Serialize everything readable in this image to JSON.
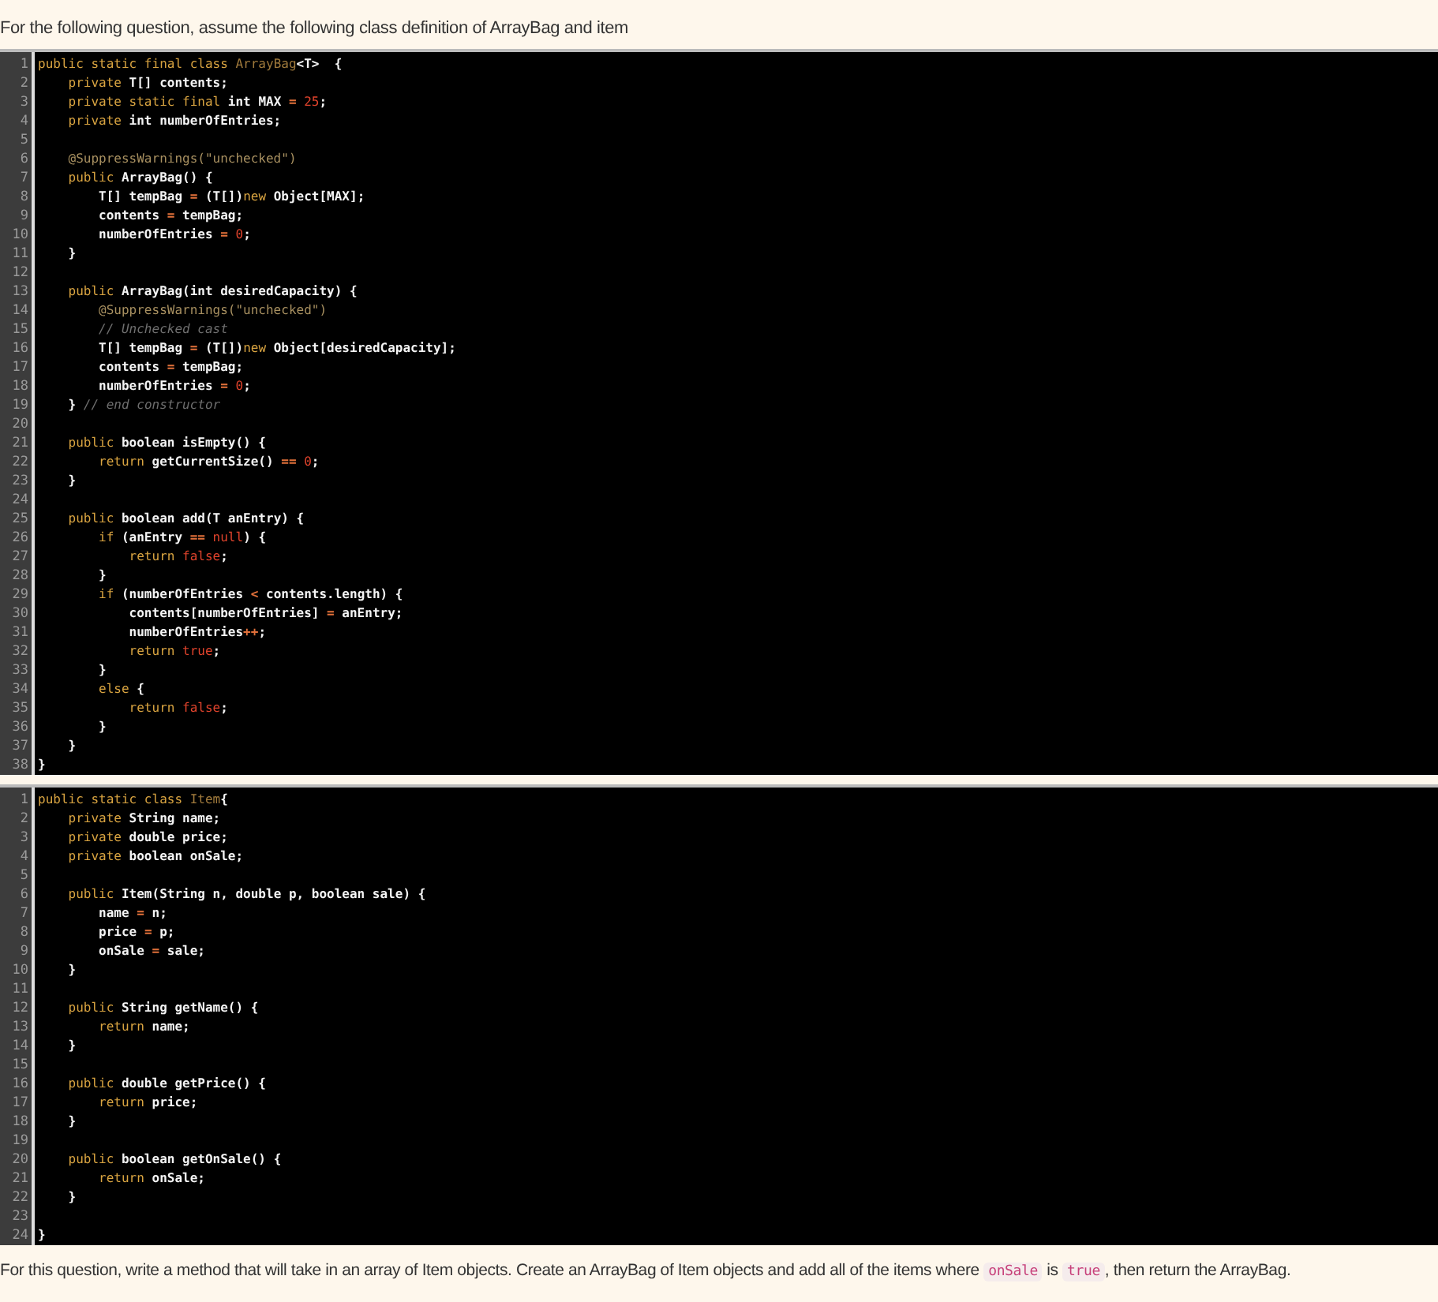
{
  "intro": "For the following question, assume the following class definition of ArrayBag and item",
  "code_blocks": [
    {
      "lines": [
        {
          "number": "1",
          "tokens": [
            {
              "kind": "kw",
              "text": "public static final class "
            },
            {
              "kind": "cls",
              "text": "ArrayBag"
            },
            {
              "kind": "plain",
              "text": "<T>  {"
            }
          ]
        },
        {
          "number": "2",
          "tokens": [
            {
              "kind": "kw",
              "text": "    private "
            },
            {
              "kind": "plain",
              "text": "T[] contents;"
            }
          ]
        },
        {
          "number": "3",
          "tokens": [
            {
              "kind": "kw",
              "text": "    private static final "
            },
            {
              "kind": "plain",
              "text": "int MAX "
            },
            {
              "kind": "op",
              "text": "= "
            },
            {
              "kind": "num",
              "text": "25"
            },
            {
              "kind": "plain",
              "text": ";"
            }
          ]
        },
        {
          "number": "4",
          "tokens": [
            {
              "kind": "kw",
              "text": "    private "
            },
            {
              "kind": "plain",
              "text": "int numberOfEntries;"
            }
          ]
        },
        {
          "number": "5"
        },
        {
          "number": "6",
          "tokens": [
            {
              "kind": "ann",
              "text": "    @SuppressWarnings(\"unchecked\")"
            }
          ]
        },
        {
          "number": "7",
          "tokens": [
            {
              "kind": "kw",
              "text": "    public "
            },
            {
              "kind": "plain",
              "text": "ArrayBag() {"
            }
          ]
        },
        {
          "number": "8",
          "tokens": [
            {
              "kind": "plain",
              "text": "        T[] tempBag "
            },
            {
              "kind": "op",
              "text": "="
            },
            {
              "kind": "plain",
              "text": " (T[])"
            },
            {
              "kind": "kw",
              "text": "new"
            },
            {
              "kind": "plain",
              "text": " Object[MAX];"
            }
          ]
        },
        {
          "number": "9",
          "tokens": [
            {
              "kind": "plain",
              "text": "        contents "
            },
            {
              "kind": "op",
              "text": "="
            },
            {
              "kind": "plain",
              "text": " tempBag;"
            }
          ]
        },
        {
          "number": "10",
          "tokens": [
            {
              "kind": "plain",
              "text": "        numberOfEntries "
            },
            {
              "kind": "op",
              "text": "= "
            },
            {
              "kind": "num",
              "text": "0"
            },
            {
              "kind": "plain",
              "text": ";"
            }
          ]
        },
        {
          "number": "11",
          "tokens": [
            {
              "kind": "plain",
              "text": "    }"
            }
          ]
        },
        {
          "number": "12"
        },
        {
          "number": "13",
          "tokens": [
            {
              "kind": "kw",
              "text": "    public "
            },
            {
              "kind": "plain",
              "text": "ArrayBag(int desiredCapacity) {"
            }
          ]
        },
        {
          "number": "14",
          "tokens": [
            {
              "kind": "ann",
              "text": "        @SuppressWarnings(\"unchecked\")"
            }
          ]
        },
        {
          "number": "15",
          "tokens": [
            {
              "kind": "cmt",
              "text": "        // Unchecked cast"
            }
          ]
        },
        {
          "number": "16",
          "tokens": [
            {
              "kind": "plain",
              "text": "        T[] tempBag "
            },
            {
              "kind": "op",
              "text": "="
            },
            {
              "kind": "plain",
              "text": " (T[])"
            },
            {
              "kind": "kw",
              "text": "new"
            },
            {
              "kind": "plain",
              "text": " Object[desiredCapacity];"
            }
          ]
        },
        {
          "number": "17",
          "tokens": [
            {
              "kind": "plain",
              "text": "        contents "
            },
            {
              "kind": "op",
              "text": "="
            },
            {
              "kind": "plain",
              "text": " tempBag;"
            }
          ]
        },
        {
          "number": "18",
          "tokens": [
            {
              "kind": "plain",
              "text": "        numberOfEntries "
            },
            {
              "kind": "op",
              "text": "= "
            },
            {
              "kind": "num",
              "text": "0"
            },
            {
              "kind": "plain",
              "text": ";"
            }
          ]
        },
        {
          "number": "19",
          "tokens": [
            {
              "kind": "plain",
              "text": "    } "
            },
            {
              "kind": "cmt",
              "text": "// end constructor"
            }
          ]
        },
        {
          "number": "20"
        },
        {
          "number": "21",
          "tokens": [
            {
              "kind": "kw",
              "text": "    public "
            },
            {
              "kind": "plain",
              "text": "boolean isEmpty() {"
            }
          ]
        },
        {
          "number": "22",
          "tokens": [
            {
              "kind": "kw",
              "text": "        return "
            },
            {
              "kind": "plain",
              "text": "getCurrentSize() "
            },
            {
              "kind": "op",
              "text": "== "
            },
            {
              "kind": "num",
              "text": "0"
            },
            {
              "kind": "plain",
              "text": ";"
            }
          ]
        },
        {
          "number": "23",
          "tokens": [
            {
              "kind": "plain",
              "text": "    }"
            }
          ]
        },
        {
          "number": "24"
        },
        {
          "number": "25",
          "tokens": [
            {
              "kind": "kw",
              "text": "    public "
            },
            {
              "kind": "plain",
              "text": "boolean add(T anEntry) {"
            }
          ]
        },
        {
          "number": "26",
          "tokens": [
            {
              "kind": "kw",
              "text": "        if "
            },
            {
              "kind": "plain",
              "text": "(anEntry "
            },
            {
              "kind": "op",
              "text": "== "
            },
            {
              "kind": "num",
              "text": "null"
            },
            {
              "kind": "plain",
              "text": ") {"
            }
          ]
        },
        {
          "number": "27",
          "tokens": [
            {
              "kind": "kw",
              "text": "            return "
            },
            {
              "kind": "num",
              "text": "false"
            },
            {
              "kind": "plain",
              "text": ";"
            }
          ]
        },
        {
          "number": "28",
          "tokens": [
            {
              "kind": "plain",
              "text": "        }"
            }
          ]
        },
        {
          "number": "29",
          "tokens": [
            {
              "kind": "kw",
              "text": "        if "
            },
            {
              "kind": "plain",
              "text": "(numberOfEntries "
            },
            {
              "kind": "op",
              "text": "<"
            },
            {
              "kind": "plain",
              "text": " contents.length) {"
            }
          ]
        },
        {
          "number": "30",
          "tokens": [
            {
              "kind": "plain",
              "text": "            contents[numberOfEntries] "
            },
            {
              "kind": "op",
              "text": "="
            },
            {
              "kind": "plain",
              "text": " anEntry;"
            }
          ]
        },
        {
          "number": "31",
          "tokens": [
            {
              "kind": "plain",
              "text": "            numberOfEntries"
            },
            {
              "kind": "op",
              "text": "++"
            },
            {
              "kind": "plain",
              "text": ";"
            }
          ]
        },
        {
          "number": "32",
          "tokens": [
            {
              "kind": "kw",
              "text": "            return "
            },
            {
              "kind": "num",
              "text": "true"
            },
            {
              "kind": "plain",
              "text": ";"
            }
          ]
        },
        {
          "number": "33",
          "tokens": [
            {
              "kind": "plain",
              "text": "        }"
            }
          ]
        },
        {
          "number": "34",
          "tokens": [
            {
              "kind": "kw",
              "text": "        else "
            },
            {
              "kind": "plain",
              "text": "{"
            }
          ]
        },
        {
          "number": "35",
          "tokens": [
            {
              "kind": "kw",
              "text": "            return "
            },
            {
              "kind": "num",
              "text": "false"
            },
            {
              "kind": "plain",
              "text": ";"
            }
          ]
        },
        {
          "number": "36",
          "tokens": [
            {
              "kind": "plain",
              "text": "        }"
            }
          ]
        },
        {
          "number": "37",
          "tokens": [
            {
              "kind": "plain",
              "text": "    }"
            }
          ]
        },
        {
          "number": "38",
          "tokens": [
            {
              "kind": "plain",
              "text": "}"
            }
          ]
        }
      ]
    },
    {
      "lines": [
        {
          "number": "1",
          "tokens": [
            {
              "kind": "kw",
              "text": "public static class "
            },
            {
              "kind": "cls",
              "text": "Item"
            },
            {
              "kind": "plain",
              "text": "{"
            }
          ]
        },
        {
          "number": "2",
          "tokens": [
            {
              "kind": "kw",
              "text": "    private "
            },
            {
              "kind": "plain",
              "text": "String name;"
            }
          ]
        },
        {
          "number": "3",
          "tokens": [
            {
              "kind": "kw",
              "text": "    private "
            },
            {
              "kind": "plain",
              "text": "double price;"
            }
          ]
        },
        {
          "number": "4",
          "tokens": [
            {
              "kind": "kw",
              "text": "    private "
            },
            {
              "kind": "plain",
              "text": "boolean onSale;"
            }
          ]
        },
        {
          "number": "5"
        },
        {
          "number": "6",
          "tokens": [
            {
              "kind": "kw",
              "text": "    public "
            },
            {
              "kind": "plain",
              "text": "Item(String n, double p, boolean sale) {"
            }
          ]
        },
        {
          "number": "7",
          "tokens": [
            {
              "kind": "plain",
              "text": "        name "
            },
            {
              "kind": "op",
              "text": "="
            },
            {
              "kind": "plain",
              "text": " n;"
            }
          ]
        },
        {
          "number": "8",
          "tokens": [
            {
              "kind": "plain",
              "text": "        price "
            },
            {
              "kind": "op",
              "text": "="
            },
            {
              "kind": "plain",
              "text": " p;"
            }
          ]
        },
        {
          "number": "9",
          "tokens": [
            {
              "kind": "plain",
              "text": "        onSale "
            },
            {
              "kind": "op",
              "text": "="
            },
            {
              "kind": "plain",
              "text": " sale;"
            }
          ]
        },
        {
          "number": "10",
          "tokens": [
            {
              "kind": "plain",
              "text": "    }"
            }
          ]
        },
        {
          "number": "11"
        },
        {
          "number": "12",
          "tokens": [
            {
              "kind": "kw",
              "text": "    public "
            },
            {
              "kind": "plain",
              "text": "String getName() {"
            }
          ]
        },
        {
          "number": "13",
          "tokens": [
            {
              "kind": "kw",
              "text": "        return "
            },
            {
              "kind": "plain",
              "text": "name;"
            }
          ]
        },
        {
          "number": "14",
          "tokens": [
            {
              "kind": "plain",
              "text": "    }"
            }
          ]
        },
        {
          "number": "15"
        },
        {
          "number": "16",
          "tokens": [
            {
              "kind": "kw",
              "text": "    public "
            },
            {
              "kind": "plain",
              "text": "double getPrice() {"
            }
          ]
        },
        {
          "number": "17",
          "tokens": [
            {
              "kind": "kw",
              "text": "        return "
            },
            {
              "kind": "plain",
              "text": "price;"
            }
          ]
        },
        {
          "number": "18",
          "tokens": [
            {
              "kind": "plain",
              "text": "    }"
            }
          ]
        },
        {
          "number": "19"
        },
        {
          "number": "20",
          "tokens": [
            {
              "kind": "kw",
              "text": "    public "
            },
            {
              "kind": "plain",
              "text": "boolean getOnSale() {"
            }
          ]
        },
        {
          "number": "21",
          "tokens": [
            {
              "kind": "kw",
              "text": "        return "
            },
            {
              "kind": "plain",
              "text": "onSale;"
            }
          ]
        },
        {
          "number": "22",
          "tokens": [
            {
              "kind": "plain",
              "text": "    }"
            }
          ]
        },
        {
          "number": "23"
        },
        {
          "number": "24",
          "tokens": [
            {
              "kind": "plain",
              "text": "}"
            }
          ]
        }
      ]
    }
  ],
  "question": [
    {
      "kind": "text",
      "text": "For this question, write a method that will take in an array of Item objects. Create an ArrayBag of Item objects and add all of the items where "
    },
    {
      "kind": "code",
      "text": "onSale"
    },
    {
      "kind": "text",
      "text": " is "
    },
    {
      "kind": "code",
      "text": "true"
    },
    {
      "kind": "text",
      "text": ", then return the ArrayBag."
    }
  ]
}
